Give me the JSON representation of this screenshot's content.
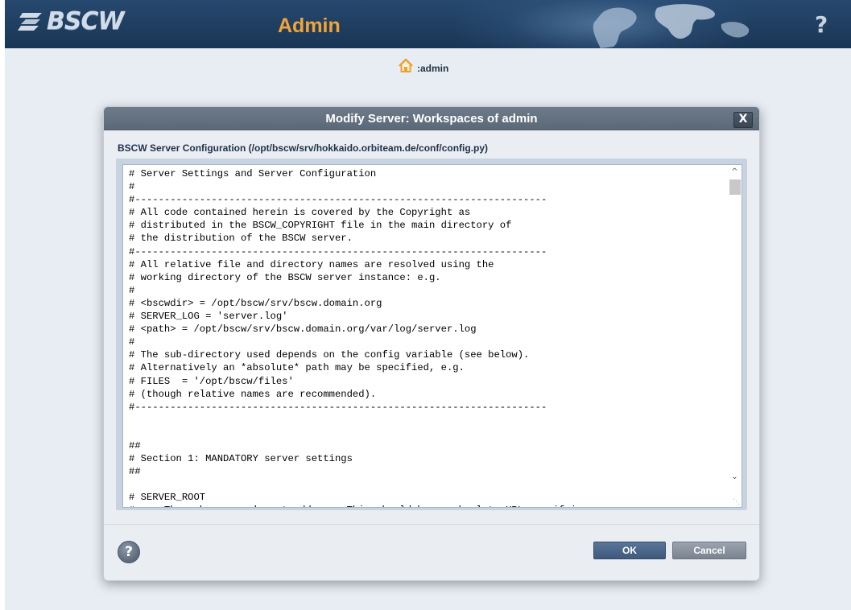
{
  "app": {
    "logo_text": "BSCW",
    "title": "Admin",
    "help_symbol": "?"
  },
  "breadcrumb": {
    "home_icon": "home-icon",
    "label": ":admin"
  },
  "dialog": {
    "title": "Modify Server: Workspaces of admin",
    "close_symbol": "X",
    "field_label": "BSCW Server Configuration (/opt/bscw/srv/hokkaido.orbiteam.de/conf/config.py)",
    "config_text": "# Server Settings and Server Configuration\n#\n#----------------------------------------------------------------------\n# All code contained herein is covered by the Copyright as\n# distributed in the BSCW_COPYRIGHT file in the main directory of\n# the distribution of the BSCW server.\n#----------------------------------------------------------------------\n# All relative file and directory names are resolved using the\n# working directory of the BSCW server instance: e.g.\n#\n# <bscwdir> = /opt/bscw/srv/bscw.domain.org\n# SERVER_LOG = 'server.log'\n# <path> = /opt/bscw/srv/bscw.domain.org/var/log/server.log\n#\n# The sub-directory used depends on the config variable (see below).\n# Alternatively an *absolute* path may be specified, e.g.\n# FILES  = '/opt/bscw/files'\n# (though relative names are recommended).\n#----------------------------------------------------------------------\n\n\n##\n# Section 1: MANDATORY server settings\n##\n\n# SERVER_ROOT\n#     The web servers' root address. This should be an absolute URL specifying",
    "help_symbol": "?",
    "ok_label": "OK",
    "cancel_label": "Cancel"
  },
  "colors": {
    "header_bg": "#1f3e60",
    "app_title": "#f2a438",
    "dialog_header": "#5b6877",
    "ok_button": "#3f5a7d",
    "cancel_button": "#7a8491"
  }
}
